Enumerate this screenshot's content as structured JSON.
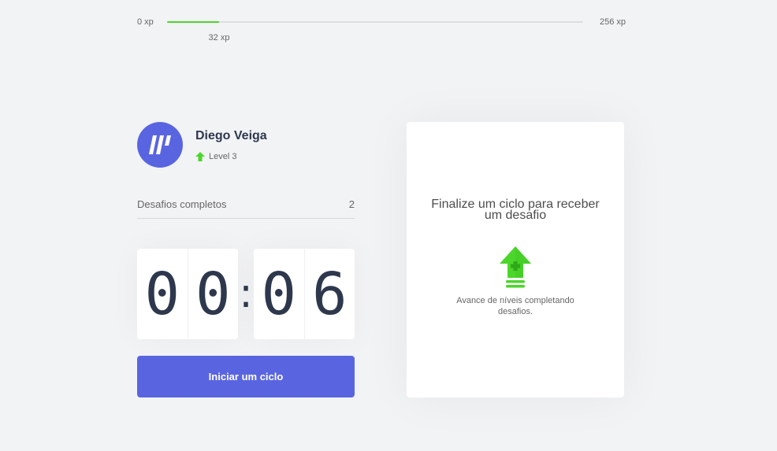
{
  "xp": {
    "start_label": "0 xp",
    "end_label": "256 xp",
    "current_label": "32 xp",
    "current": 32,
    "max": 256,
    "accent_color": "#4cd62b"
  },
  "profile": {
    "name": "Diego Veiga",
    "level_label": "Level 3",
    "avatar_icon": "logo-stripes-icon",
    "level_icon": "level-up-arrow-icon"
  },
  "completed": {
    "label": "Desafios completos",
    "count": "2"
  },
  "countdown": {
    "minute_left": "0",
    "minute_right": "0",
    "separator": ":",
    "second_left": "0",
    "second_right": "6"
  },
  "actions": {
    "start_label": "Iniciar um ciclo",
    "button_color": "#5965e0"
  },
  "challenge": {
    "title": "Finalize um ciclo para receber um desafio",
    "hint": "Avance de níveis completando desafios.",
    "icon": "level-up-icon"
  }
}
